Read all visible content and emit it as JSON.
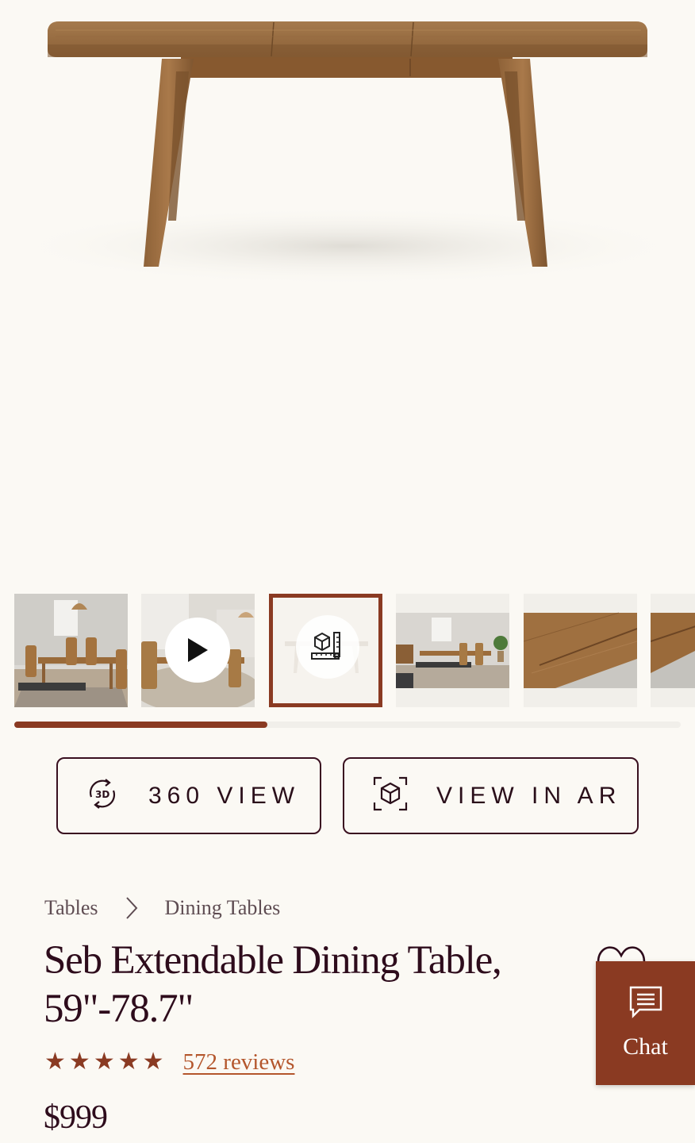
{
  "gallery": {
    "progress": 0.38,
    "thumbnails": [
      {
        "name": "thumb-lifestyle-dining-room",
        "type": "image"
      },
      {
        "name": "thumb-video",
        "type": "video",
        "icon": "play-icon"
      },
      {
        "name": "thumb-dimensions",
        "type": "dimensions",
        "icon": "dimensions-icon",
        "selected": true
      },
      {
        "name": "thumb-dining-room-wide",
        "type": "image"
      },
      {
        "name": "thumb-wood-closeup",
        "type": "image"
      },
      {
        "name": "thumb-extension-closeup",
        "type": "image"
      }
    ]
  },
  "actions": {
    "view_360_label": "360 VIEW",
    "view_360_icon": "rotate-360-icon",
    "view_ar_label": "VIEW IN AR",
    "view_ar_icon": "ar-cube-icon"
  },
  "breadcrumb": {
    "items": [
      "Tables",
      "Dining Tables"
    ],
    "separator_icon": "chevron-right-icon"
  },
  "product": {
    "title_line1": "Seb Extendable Dining Table,",
    "title_line2": "59\"-78.7\"",
    "rating": 5,
    "reviews_label": "572 reviews",
    "price": "$999",
    "favorite_icon": "heart-icon"
  },
  "chat": {
    "label": "Chat",
    "icon": "chat-bubble-icon"
  },
  "colors": {
    "accent": "#8a3a22",
    "text": "#2e0c1c",
    "link": "#b4562c",
    "background": "#fbf9f4"
  }
}
